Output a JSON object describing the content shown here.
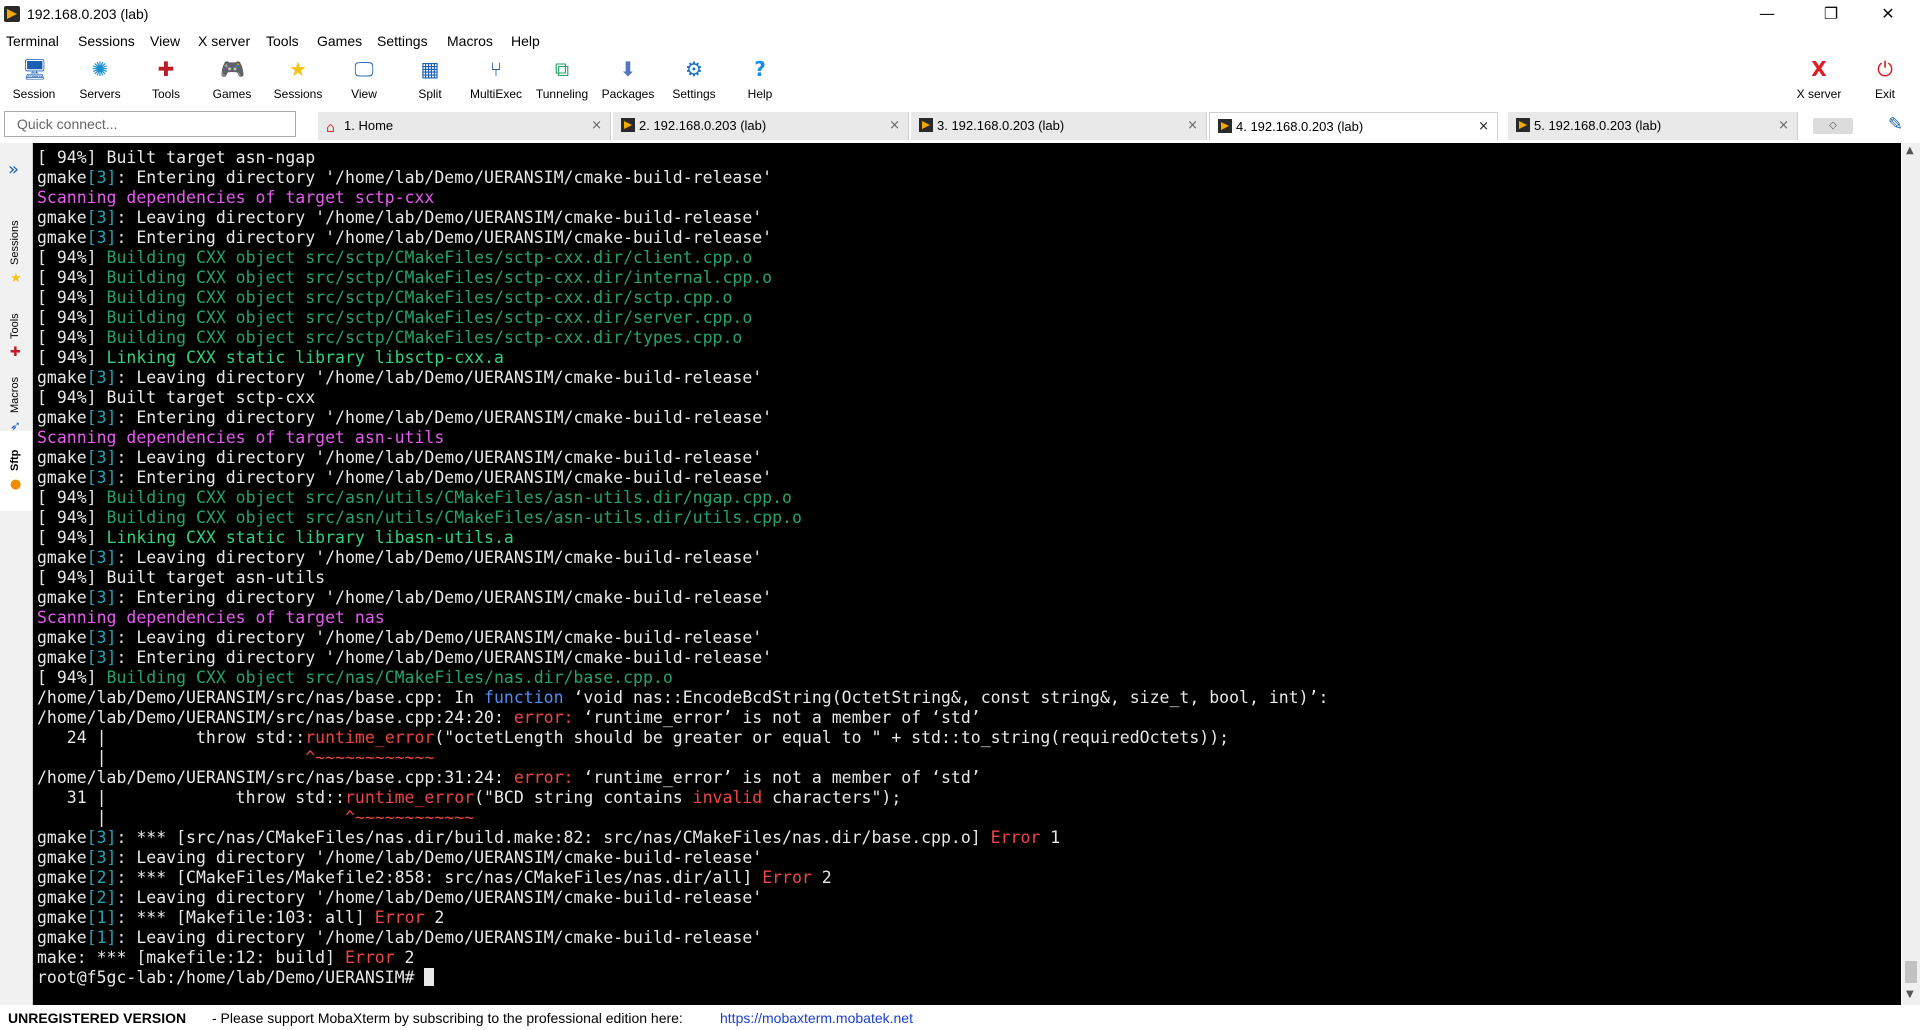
{
  "window": {
    "title": "192.168.0.203 (lab)",
    "minimize": "—",
    "maximize": "❐",
    "close": "✕"
  },
  "menu": [
    "Terminal",
    "Sessions",
    "View",
    "X server",
    "Tools",
    "Games",
    "Settings",
    "Macros",
    "Help"
  ],
  "toolbar": [
    {
      "label": "Session",
      "icon": "monitor-session-icon",
      "glyph": "🖥",
      "color": "#1a5fb4"
    },
    {
      "label": "Servers",
      "icon": "servers-icon",
      "glyph": "✺",
      "color": "#1a8fd0"
    },
    {
      "label": "Tools",
      "icon": "tools-icon",
      "glyph": "✚",
      "color": "#c01c28"
    },
    {
      "label": "Games",
      "icon": "games-icon",
      "glyph": "🎮",
      "color": "#555555"
    },
    {
      "label": "Sessions",
      "icon": "sessions-star-icon",
      "glyph": "★",
      "color": "#f5c211"
    },
    {
      "label": "View",
      "icon": "view-icon",
      "glyph": "🖵",
      "color": "#2a6fb4"
    },
    {
      "label": "Split",
      "icon": "split-icon",
      "glyph": "▦",
      "color": "#1a5fb4"
    },
    {
      "label": "MultiExec",
      "icon": "multiexec-icon",
      "glyph": "⑂",
      "color": "#3355aa"
    },
    {
      "label": "Tunneling",
      "icon": "tunneling-icon",
      "glyph": "⧉",
      "color": "#26a269"
    },
    {
      "label": "Packages",
      "icon": "packages-icon",
      "glyph": "⬇",
      "color": "#5577bb"
    },
    {
      "label": "Settings",
      "icon": "settings-gear-icon",
      "glyph": "⚙",
      "color": "#1a6fd0"
    },
    {
      "label": "Help",
      "icon": "help-icon",
      "glyph": "?",
      "color": "#1a8fe0"
    }
  ],
  "toolbar_right": [
    {
      "label": "X server",
      "icon": "x-server-icon",
      "glyph": "X",
      "color": "#e01b24"
    },
    {
      "label": "Exit",
      "icon": "exit-power-icon",
      "glyph": "⏻",
      "color": "#e01b24"
    }
  ],
  "quick_connect": {
    "placeholder": "Quick connect..."
  },
  "tabs": [
    {
      "label": "1. Home",
      "type": "home",
      "active": false
    },
    {
      "label": "2. 192.168.0.203 (lab)",
      "type": "term",
      "active": false
    },
    {
      "label": "3. 192.168.0.203 (lab)",
      "type": "term",
      "active": false
    },
    {
      "label": "4. 192.168.0.203 (lab)",
      "type": "term",
      "active": true
    },
    {
      "label": "5. 192.168.0.203 (lab)",
      "type": "term",
      "active": false
    }
  ],
  "tab_close": "×",
  "tab_extra": "◇",
  "side": {
    "toggle": "»",
    "tabs": [
      {
        "label": "Sessions",
        "icon": "star-icon",
        "glyph": "★",
        "color": "#f5c211"
      },
      {
        "label": "Tools",
        "icon": "tools-icon",
        "glyph": "✚",
        "color": "#c01c28"
      },
      {
        "label": "Macros",
        "icon": "macros-icon",
        "glyph": "➶",
        "color": "#1a5fb4"
      },
      {
        "label": "Sftp",
        "icon": "sftp-icon",
        "glyph": "●",
        "color": "#f08c00"
      }
    ]
  },
  "terminal_lines": [
    [
      {
        "t": "[ 94%] Built target asn-ngap"
      }
    ],
    [
      {
        "t": "gmake"
      },
      {
        "t": "[3]",
        "c": "cyan"
      },
      {
        "t": ": Entering directory '/home/lab/Demo/UERANSIM/cmake-build-release'"
      }
    ],
    [
      {
        "t": "Scanning dependencies of target sctp-cxx",
        "c": "mag"
      }
    ],
    [
      {
        "t": "gmake"
      },
      {
        "t": "[3]",
        "c": "cyan"
      },
      {
        "t": ": Leaving directory '/home/lab/Demo/UERANSIM/cmake-build-release'"
      }
    ],
    [
      {
        "t": "gmake"
      },
      {
        "t": "[3]",
        "c": "cyan"
      },
      {
        "t": ": Entering directory '/home/lab/Demo/UERANSIM/cmake-build-release'"
      }
    ],
    [
      {
        "t": "[ 94%] "
      },
      {
        "t": "Building CXX object src/sctp/CMakeFiles/sctp-cxx.dir/client.cpp.o",
        "c": "grn"
      }
    ],
    [
      {
        "t": "[ 94%] "
      },
      {
        "t": "Building CXX object src/sctp/CMakeFiles/sctp-cxx.dir/internal.cpp.o",
        "c": "grn"
      }
    ],
    [
      {
        "t": "[ 94%] "
      },
      {
        "t": "Building CXX object src/sctp/CMakeFiles/sctp-cxx.dir/sctp.cpp.o",
        "c": "grn"
      }
    ],
    [
      {
        "t": "[ 94%] "
      },
      {
        "t": "Building CXX object src/sctp/CMakeFiles/sctp-cxx.dir/server.cpp.o",
        "c": "grn"
      }
    ],
    [
      {
        "t": "[ 94%] "
      },
      {
        "t": "Building CXX object src/sctp/CMakeFiles/sctp-cxx.dir/types.cpp.o",
        "c": "grn"
      }
    ],
    [
      {
        "t": "[ 94%] "
      },
      {
        "t": "Linking CXX static library libsctp-cxx.a",
        "c": "bgrn"
      }
    ],
    [
      {
        "t": "gmake"
      },
      {
        "t": "[3]",
        "c": "cyan"
      },
      {
        "t": ": Leaving directory '/home/lab/Demo/UERANSIM/cmake-build-release'"
      }
    ],
    [
      {
        "t": "[ 94%] Built target sctp-cxx"
      }
    ],
    [
      {
        "t": "gmake"
      },
      {
        "t": "[3]",
        "c": "cyan"
      },
      {
        "t": ": Entering directory '/home/lab/Demo/UERANSIM/cmake-build-release'"
      }
    ],
    [
      {
        "t": "Scanning dependencies of target asn-utils",
        "c": "mag"
      }
    ],
    [
      {
        "t": "gmake"
      },
      {
        "t": "[3]",
        "c": "cyan"
      },
      {
        "t": ": Leaving directory '/home/lab/Demo/UERANSIM/cmake-build-release'"
      }
    ],
    [
      {
        "t": "gmake"
      },
      {
        "t": "[3]",
        "c": "cyan"
      },
      {
        "t": ": Entering directory '/home/lab/Demo/UERANSIM/cmake-build-release'"
      }
    ],
    [
      {
        "t": "[ 94%] "
      },
      {
        "t": "Building CXX object src/asn/utils/CMakeFiles/asn-utils.dir/ngap.cpp.o",
        "c": "grn"
      }
    ],
    [
      {
        "t": "[ 94%] "
      },
      {
        "t": "Building CXX object src/asn/utils/CMakeFiles/asn-utils.dir/utils.cpp.o",
        "c": "grn"
      }
    ],
    [
      {
        "t": "[ 94%] "
      },
      {
        "t": "Linking CXX static library libasn-utils.a",
        "c": "bgrn"
      }
    ],
    [
      {
        "t": "gmake"
      },
      {
        "t": "[3]",
        "c": "cyan"
      },
      {
        "t": ": Leaving directory '/home/lab/Demo/UERANSIM/cmake-build-release'"
      }
    ],
    [
      {
        "t": "[ 94%] Built target asn-utils"
      }
    ],
    [
      {
        "t": "gmake"
      },
      {
        "t": "[3]",
        "c": "cyan"
      },
      {
        "t": ": Entering directory '/home/lab/Demo/UERANSIM/cmake-build-release'"
      }
    ],
    [
      {
        "t": "Scanning dependencies of target nas",
        "c": "mag"
      }
    ],
    [
      {
        "t": "gmake"
      },
      {
        "t": "[3]",
        "c": "cyan"
      },
      {
        "t": ": Leaving directory '/home/lab/Demo/UERANSIM/cmake-build-release'"
      }
    ],
    [
      {
        "t": "gmake"
      },
      {
        "t": "[3]",
        "c": "cyan"
      },
      {
        "t": ": Entering directory '/home/lab/Demo/UERANSIM/cmake-build-release'"
      }
    ],
    [
      {
        "t": "[ 94%] "
      },
      {
        "t": "Building CXX object src/nas/CMakeFiles/nas.dir/base.cpp.o",
        "c": "grn"
      }
    ],
    [
      {
        "t": "/home/lab/Demo/UERANSIM/src/nas/base.cpp: In "
      },
      {
        "t": "function",
        "c": "blue"
      },
      {
        "t": " ‘void nas::EncodeBcdString(OctetString&, const string&, size_t, bool, int)’:"
      }
    ],
    [
      {
        "t": "/home/lab/Demo/UERANSIM/src/nas/base.cpp:24:20: "
      },
      {
        "t": "error: ",
        "c": "err"
      },
      {
        "t": "‘runtime_error’ is not a member of ‘std’"
      }
    ],
    [
      {
        "t": "   24 |         throw std::"
      },
      {
        "t": "runtime_error",
        "c": "red"
      },
      {
        "t": "(\"octetLength should be greater or equal to \" + std::to_string(requiredOctets));"
      }
    ],
    [
      {
        "t": "      |                    "
      },
      {
        "t": "^~~~~~~~~~~~~",
        "c": "red"
      }
    ],
    [
      {
        "t": "/home/lab/Demo/UERANSIM/src/nas/base.cpp:31:24: "
      },
      {
        "t": "error: ",
        "c": "err"
      },
      {
        "t": "‘runtime_error’ is not a member of ‘std’"
      }
    ],
    [
      {
        "t": "   31 |             throw std::"
      },
      {
        "t": "runtime_error",
        "c": "red"
      },
      {
        "t": "(\"BCD string contains "
      },
      {
        "t": "invalid",
        "c": "red"
      },
      {
        "t": " characters\");"
      }
    ],
    [
      {
        "t": "      |                        "
      },
      {
        "t": "^~~~~~~~~~~~~",
        "c": "red"
      }
    ],
    [
      {
        "t": "gmake"
      },
      {
        "t": "[3]",
        "c": "cyan"
      },
      {
        "t": ": *** [src/nas/CMakeFiles/nas.dir/build.make:82: src/nas/CMakeFiles/nas.dir/base.cpp.o] "
      },
      {
        "t": "Error",
        "c": "err"
      },
      {
        "t": " 1"
      }
    ],
    [
      {
        "t": "gmake"
      },
      {
        "t": "[3]",
        "c": "cyan"
      },
      {
        "t": ": Leaving directory '/home/lab/Demo/UERANSIM/cmake-build-release'"
      }
    ],
    [
      {
        "t": "gmake"
      },
      {
        "t": "[2]",
        "c": "cyan"
      },
      {
        "t": ": *** [CMakeFiles/Makefile2:858: src/nas/CMakeFiles/nas.dir/all] "
      },
      {
        "t": "Error",
        "c": "err"
      },
      {
        "t": " 2"
      }
    ],
    [
      {
        "t": "gmake"
      },
      {
        "t": "[2]",
        "c": "cyan"
      },
      {
        "t": ": Leaving directory '/home/lab/Demo/UERANSIM/cmake-build-release'"
      }
    ],
    [
      {
        "t": "gmake"
      },
      {
        "t": "[1]",
        "c": "cyan"
      },
      {
        "t": ": *** [Makefile:103: all] "
      },
      {
        "t": "Error",
        "c": "err"
      },
      {
        "t": " 2"
      }
    ],
    [
      {
        "t": "gmake"
      },
      {
        "t": "[1]",
        "c": "cyan"
      },
      {
        "t": ": Leaving directory '/home/lab/Demo/UERANSIM/cmake-build-release'"
      }
    ],
    [
      {
        "t": "make: *** [makefile:12: build] "
      },
      {
        "t": "Error",
        "c": "err"
      },
      {
        "t": " 2"
      }
    ],
    [
      {
        "t": "root@f5gc-lab:/home/lab/Demo/UERANSIM# "
      },
      {
        "cursor": true
      }
    ]
  ],
  "scrollbar": {
    "up": "▲",
    "down": "▼"
  },
  "status": {
    "unregistered": "UNREGISTERED VERSION",
    "message": "-  Please support MobaXterm by subscribing to the professional edition here:",
    "link": "https://mobaxterm.mobatek.net"
  }
}
